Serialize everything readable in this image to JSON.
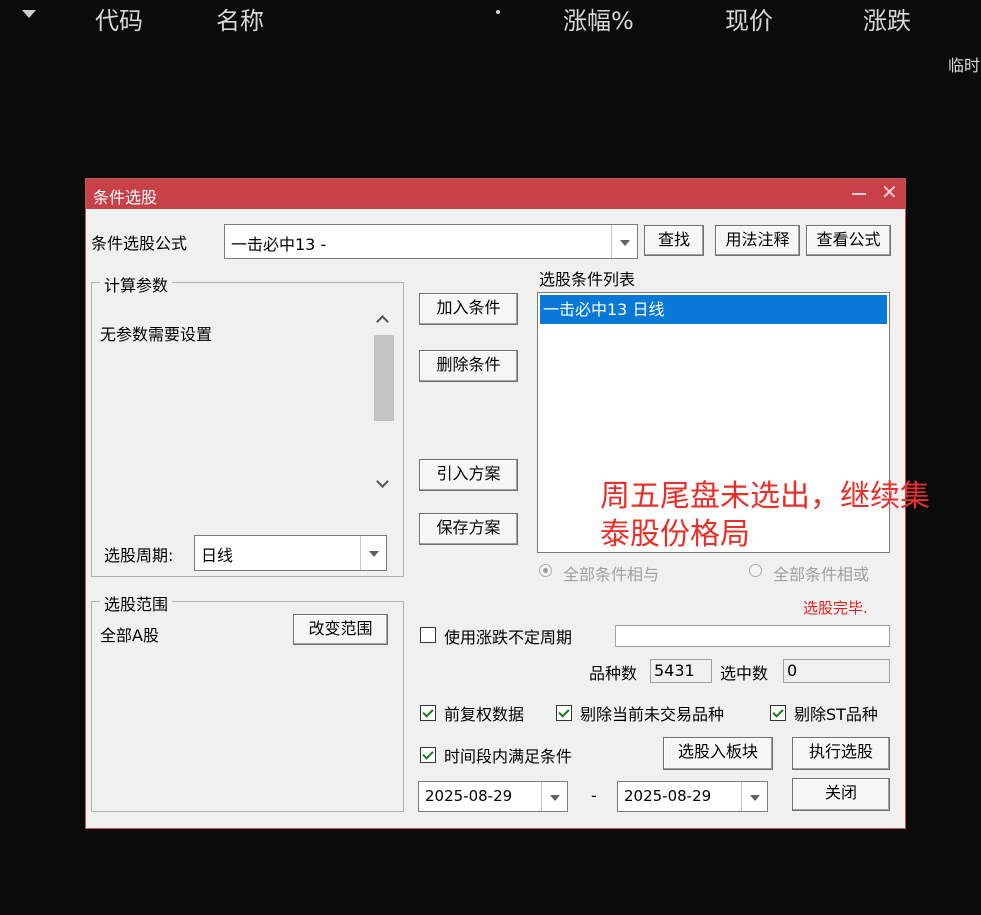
{
  "header": {
    "columns": [
      "代码",
      "名称",
      "涨幅%",
      "现价",
      "涨跌"
    ],
    "temp_label": "临时"
  },
  "dialog": {
    "title": "条件选股",
    "formula_label": "条件选股公式",
    "formula_value": "一击必中13  -",
    "find_btn": "查找",
    "usage_btn": "用法注释",
    "view_btn": "查看公式",
    "params_group": "计算参数",
    "params_text": "无参数需要设置",
    "period_label": "选股周期:",
    "period_value": "日线",
    "scope_group": "选股范围",
    "scope_value": "全部A股",
    "change_scope_btn": "改变范围",
    "add_btn": "加入条件",
    "del_btn": "删除条件",
    "import_btn": "引入方案",
    "save_btn": "保存方案",
    "list_label": "选股条件列表",
    "list_items": [
      "一击必中13  日线"
    ],
    "radio_and": "全部条件相与",
    "radio_or": "全部条件相或",
    "status": "选股完毕.",
    "variable_period_label": "使用涨跌不定周期",
    "count_label": "品种数",
    "count_value": "5431",
    "selected_label": "选中数",
    "selected_value": "0",
    "cb_adjust": "前复权数据",
    "cb_exclude_nontrading": "剔除当前未交易品种",
    "cb_exclude_st": "剔除ST品种",
    "cb_timerange": "时间段内满足条件",
    "to_block_btn": "选股入板块",
    "run_btn": "执行选股",
    "date_from": "2025-08-29",
    "date_sep": "-",
    "date_to": "2025-08-29",
    "close_btn": "关闭"
  },
  "annotation": {
    "line1": "周五尾盘未选出，继续集",
    "line2": "泰股份格局",
    "color": "#e8302a"
  }
}
